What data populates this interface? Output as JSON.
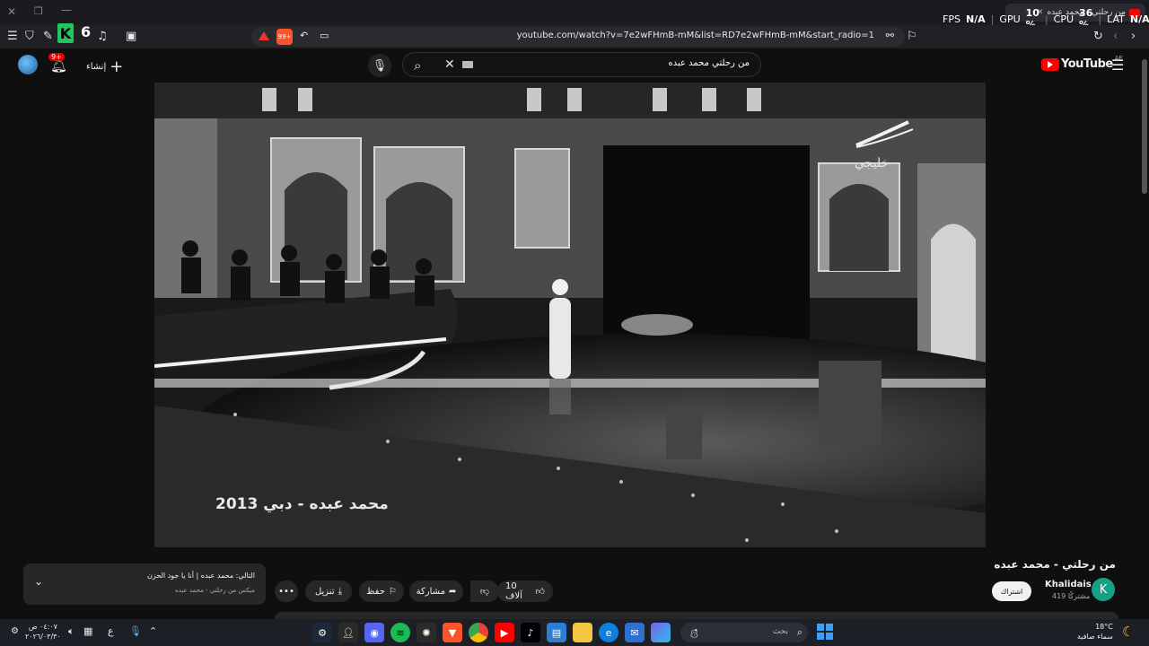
{
  "browser": {
    "tab_title": "من رحلتي - محمد عبده",
    "url": "youtube.com/watch?v=7e2wFHmB-mM&list=RD7e2wFHmB-mM&start_radio=1",
    "k_logo": "K",
    "k_badge": "6",
    "brave_badge": "99+"
  },
  "overlay": {
    "fps_label": "FPS",
    "fps_value": "N/A",
    "gpu_label": "GPU",
    "gpu_value": "10 %",
    "cpu_label": "CPU",
    "cpu_value": "36 %",
    "lat_label": "LAT",
    "lat_value": "N/A"
  },
  "youtube": {
    "logo_text": "YouTube",
    "region": "AE",
    "search_value": "من رحلتي محمد عبده",
    "create_label": "إنشاء",
    "notif_count": "9+"
  },
  "video": {
    "caption": "محمد عبده - دبي 2013",
    "channel_watermark": "خليجي"
  },
  "info": {
    "title": "من رحلتي - محمد عبده",
    "channel_name": "Khalidais",
    "channel_initial": "K",
    "subscribers": "419 مشتركًا",
    "subscribe_label": "اشتراك",
    "like_count": "10 آلاف",
    "share_label": "مشاركة",
    "save_label": "حفظ",
    "download_label": "تنزيل"
  },
  "next_card": {
    "title": "التالي: محمد عبده | أنا يا جود الحزن",
    "subtitle": "ميكس من رحلتي - محمد عبده"
  },
  "taskbar": {
    "search_placeholder": "بحث",
    "weather_temp": "18°C",
    "weather_desc": "سماء صافية",
    "time": "٠٤:٠٧ ص",
    "date": "٢٠٢٦/٠٣/٣٠",
    "lang": "ع"
  },
  "colors": {
    "yt_red": "#ff0000",
    "accent_green": "#22c55e",
    "avatar_teal": "#16a085"
  }
}
